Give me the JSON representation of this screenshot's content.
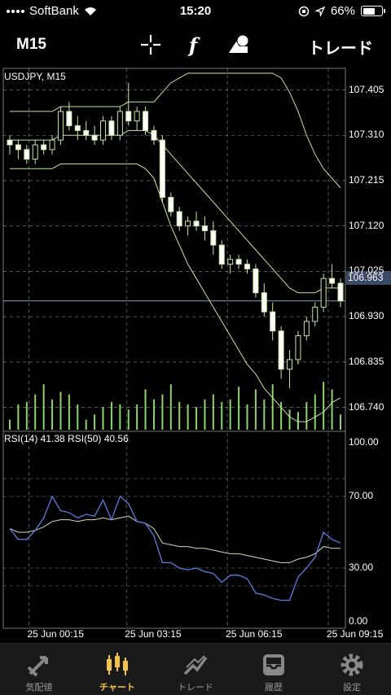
{
  "status": {
    "carrier": "SoftBank",
    "time": "15:20",
    "battery": "66%",
    "battery_level": 0.66
  },
  "toolbar": {
    "timeframe": "M15",
    "crosshair_icon": "crosshair-icon",
    "indicator_label": "f",
    "objects_icon": "shapes-icon",
    "trade_label": "トレード"
  },
  "chart": {
    "symbol_label": "USDJPY, M15",
    "price_labels": [
      "107.405",
      "107.310",
      "107.215",
      "107.120",
      "107.025",
      "106.930",
      "106.835",
      "106.740"
    ],
    "current_price": "106.963",
    "rsi_label": "RSI(14) 41.38 RSI(50) 40.56",
    "rsi_labels": [
      "100.00",
      "70.00",
      "30.00",
      "0.00"
    ],
    "time_labels": [
      "25 Jun 00:15",
      "25 Jun 03:15",
      "25 Jun 06:15",
      "25 Jun 09:15"
    ],
    "colors": {
      "up": "#000000",
      "down": "#ffffff",
      "bands": "#c8e6a0",
      "volume": "#8fd46a",
      "rsi14": "#5a7de0",
      "rsi50": "#d8d8c0",
      "grid": "#ffffff"
    }
  },
  "chart_data": {
    "type": "candlestick",
    "symbol": "USDJPY",
    "timeframe": "M15",
    "ylim": [
      106.7,
      107.44
    ],
    "current_price": 106.963,
    "candles": [
      {
        "o": 107.3,
        "h": 107.31,
        "l": 107.27,
        "c": 107.29
      },
      {
        "o": 107.29,
        "h": 107.3,
        "l": 107.26,
        "c": 107.28
      },
      {
        "o": 107.28,
        "h": 107.29,
        "l": 107.25,
        "c": 107.26
      },
      {
        "o": 107.26,
        "h": 107.3,
        "l": 107.25,
        "c": 107.29
      },
      {
        "o": 107.29,
        "h": 107.3,
        "l": 107.27,
        "c": 107.28
      },
      {
        "o": 107.28,
        "h": 107.31,
        "l": 107.27,
        "c": 107.3
      },
      {
        "o": 107.3,
        "h": 107.37,
        "l": 107.29,
        "c": 107.36
      },
      {
        "o": 107.36,
        "h": 107.38,
        "l": 107.32,
        "c": 107.33
      },
      {
        "o": 107.33,
        "h": 107.35,
        "l": 107.3,
        "c": 107.32
      },
      {
        "o": 107.32,
        "h": 107.34,
        "l": 107.3,
        "c": 107.31
      },
      {
        "o": 107.31,
        "h": 107.33,
        "l": 107.29,
        "c": 107.3
      },
      {
        "o": 107.3,
        "h": 107.35,
        "l": 107.29,
        "c": 107.34
      },
      {
        "o": 107.34,
        "h": 107.35,
        "l": 107.3,
        "c": 107.31
      },
      {
        "o": 107.31,
        "h": 107.37,
        "l": 107.3,
        "c": 107.36
      },
      {
        "o": 107.36,
        "h": 107.42,
        "l": 107.33,
        "c": 107.34
      },
      {
        "o": 107.34,
        "h": 107.37,
        "l": 107.32,
        "c": 107.36
      },
      {
        "o": 107.36,
        "h": 107.37,
        "l": 107.31,
        "c": 107.32
      },
      {
        "o": 107.32,
        "h": 107.33,
        "l": 107.29,
        "c": 107.3
      },
      {
        "o": 107.3,
        "h": 107.31,
        "l": 107.17,
        "c": 107.18
      },
      {
        "o": 107.18,
        "h": 107.19,
        "l": 107.14,
        "c": 107.15
      },
      {
        "o": 107.15,
        "h": 107.16,
        "l": 107.11,
        "c": 107.12
      },
      {
        "o": 107.12,
        "h": 107.14,
        "l": 107.1,
        "c": 107.13
      },
      {
        "o": 107.13,
        "h": 107.15,
        "l": 107.11,
        "c": 107.12
      },
      {
        "o": 107.12,
        "h": 107.14,
        "l": 107.09,
        "c": 107.11
      },
      {
        "o": 107.11,
        "h": 107.13,
        "l": 107.06,
        "c": 107.08
      },
      {
        "o": 107.08,
        "h": 107.09,
        "l": 107.03,
        "c": 107.04
      },
      {
        "o": 107.04,
        "h": 107.06,
        "l": 107.02,
        "c": 107.05
      },
      {
        "o": 107.05,
        "h": 107.06,
        "l": 107.03,
        "c": 107.04
      },
      {
        "o": 107.04,
        "h": 107.05,
        "l": 107.02,
        "c": 107.03
      },
      {
        "o": 107.03,
        "h": 107.04,
        "l": 106.97,
        "c": 106.98
      },
      {
        "o": 106.98,
        "h": 107.0,
        "l": 106.93,
        "c": 106.94
      },
      {
        "o": 106.94,
        "h": 106.96,
        "l": 106.88,
        "c": 106.9
      },
      {
        "o": 106.9,
        "h": 106.91,
        "l": 106.8,
        "c": 106.82
      },
      {
        "o": 106.82,
        "h": 106.86,
        "l": 106.78,
        "c": 106.84
      },
      {
        "o": 106.84,
        "h": 106.9,
        "l": 106.83,
        "c": 106.89
      },
      {
        "o": 106.89,
        "h": 106.93,
        "l": 106.88,
        "c": 106.92
      },
      {
        "o": 106.92,
        "h": 106.96,
        "l": 106.91,
        "c": 106.95
      },
      {
        "o": 106.95,
        "h": 107.02,
        "l": 106.94,
        "c": 107.01
      },
      {
        "o": 107.01,
        "h": 107.04,
        "l": 106.99,
        "c": 107.0
      },
      {
        "o": 107.0,
        "h": 107.01,
        "l": 106.95,
        "c": 106.963
      }
    ],
    "bollinger_upper": [
      107.36,
      107.36,
      107.36,
      107.36,
      107.36,
      107.36,
      107.37,
      107.37,
      107.37,
      107.37,
      107.37,
      107.37,
      107.37,
      107.37,
      107.38,
      107.38,
      107.38,
      107.38,
      107.4,
      107.42,
      107.43,
      107.44,
      107.44,
      107.44,
      107.44,
      107.44,
      107.44,
      107.44,
      107.44,
      107.44,
      107.44,
      107.44,
      107.43,
      107.4,
      107.36,
      107.31,
      107.27,
      107.24,
      107.22,
      107.2
    ],
    "bollinger_mid": [
      107.3,
      107.3,
      107.3,
      107.3,
      107.3,
      107.3,
      107.31,
      107.31,
      107.31,
      107.31,
      107.31,
      107.31,
      107.31,
      107.31,
      107.32,
      107.32,
      107.32,
      107.31,
      107.29,
      107.27,
      107.25,
      107.23,
      107.21,
      107.19,
      107.17,
      107.15,
      107.13,
      107.11,
      107.09,
      107.07,
      107.05,
      107.03,
      107.01,
      106.99,
      106.98,
      106.98,
      106.98,
      106.99,
      106.99,
      106.99
    ],
    "bollinger_lower": [
      107.24,
      107.24,
      107.24,
      107.24,
      107.24,
      107.24,
      107.25,
      107.25,
      107.25,
      107.25,
      107.25,
      107.25,
      107.25,
      107.25,
      107.25,
      107.25,
      107.24,
      107.22,
      107.17,
      107.12,
      107.08,
      107.04,
      107.01,
      106.98,
      106.95,
      106.92,
      106.89,
      106.86,
      106.83,
      106.81,
      106.78,
      106.76,
      106.74,
      106.72,
      106.71,
      106.71,
      106.72,
      106.73,
      106.75,
      106.76
    ],
    "volume": [
      0.2,
      0.5,
      0.55,
      0.7,
      0.9,
      0.6,
      0.75,
      0.7,
      0.5,
      0.2,
      0.3,
      0.45,
      0.55,
      0.5,
      0.4,
      0.5,
      0.8,
      0.6,
      0.7,
      0.9,
      0.55,
      0.5,
      0.45,
      0.6,
      0.7,
      0.55,
      0.6,
      0.85,
      0.5,
      0.8,
      0.6,
      0.9,
      0.55,
      0.4,
      0.35,
      0.55,
      0.7,
      0.95,
      0.8,
      0.3
    ],
    "rsi14": [
      52,
      46,
      46,
      51,
      58,
      70,
      62,
      61,
      58,
      60,
      59,
      68,
      57,
      70,
      66,
      56,
      55,
      48,
      33,
      33,
      30,
      29,
      30,
      28,
      27,
      22,
      26,
      26,
      24,
      16,
      15,
      13,
      12,
      12,
      25,
      30,
      36,
      50,
      46,
      44
    ],
    "rsi50": [
      52,
      50,
      50,
      51,
      53,
      56,
      57,
      57,
      56,
      57,
      57,
      58,
      57,
      58,
      59,
      56,
      55,
      52,
      44,
      43,
      42,
      42,
      41,
      41,
      40,
      39,
      38,
      38,
      37,
      36,
      35,
      34,
      33,
      33,
      35,
      36,
      38,
      42,
      41,
      41
    ],
    "rsi_levels": [
      80,
      70,
      30,
      20
    ],
    "rsi_ylim": [
      0,
      100
    ],
    "x_labels": [
      "25 Jun 00:15",
      "25 Jun 03:15",
      "25 Jun 06:15",
      "25 Jun 09:15"
    ],
    "grid": true
  },
  "tabs": [
    {
      "label": "気配値",
      "icon": "quotes-icon"
    },
    {
      "label": "チャート",
      "icon": "chart-icon"
    },
    {
      "label": "トレード",
      "icon": "trade-icon"
    },
    {
      "label": "履歴",
      "icon": "history-icon"
    },
    {
      "label": "設定",
      "icon": "settings-icon"
    }
  ]
}
